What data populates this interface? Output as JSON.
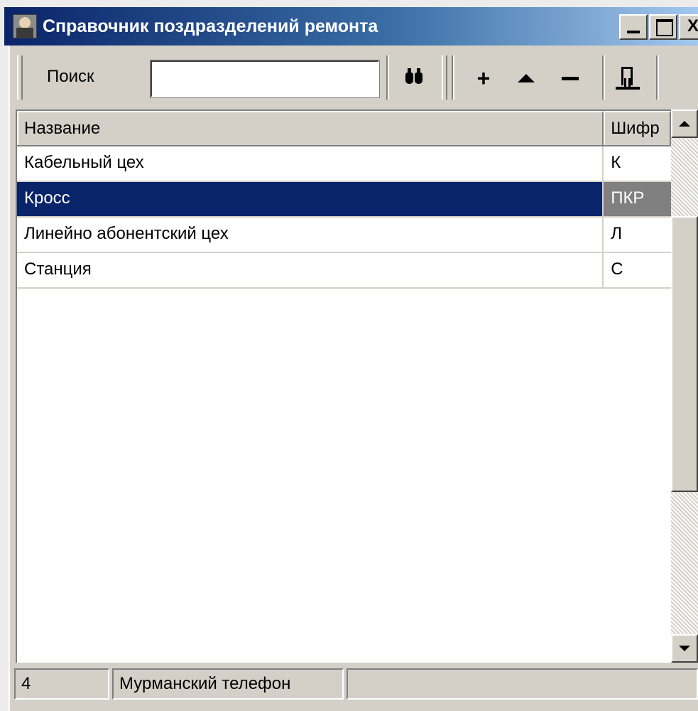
{
  "window": {
    "title": "Справочник поздразделений ремонта",
    "controls": {
      "minimize": "_",
      "maximize": "□",
      "close": "X"
    }
  },
  "toolbar": {
    "search_label": "Поиск",
    "search_value": "",
    "find_icon": "binoculars-icon",
    "add_label": "+",
    "up_icon": "triangle-up-icon",
    "remove_label": "—",
    "exit_icon": "exit-door-icon"
  },
  "grid": {
    "columns": [
      "Название",
      "Шифр"
    ],
    "rows": [
      {
        "name": "Кабельный цех",
        "code": "К",
        "selected": false
      },
      {
        "name": "Кросс",
        "code": "ПКР",
        "selected": true
      },
      {
        "name": "Линейно абонентский цех",
        "code": "Л",
        "selected": false
      },
      {
        "name": "Станция",
        "code": "С",
        "selected": false
      }
    ]
  },
  "status": {
    "count": "4",
    "company": "Мурманский телефон",
    "extra": ""
  },
  "colors": {
    "title_gradient_start": "#0a246a",
    "title_gradient_end": "#a6caf0",
    "selection": "#0a246a",
    "face": "#d4d0c8"
  }
}
